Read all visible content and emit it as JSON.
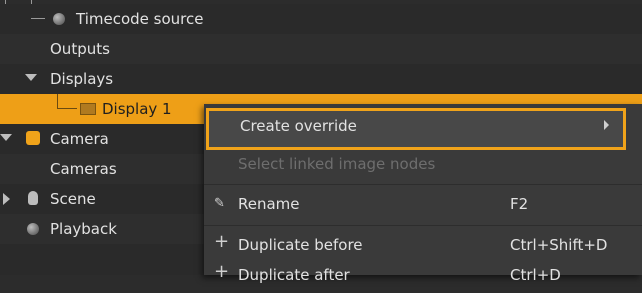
{
  "tree": {
    "items": [
      {
        "label": "Timecode source",
        "icon": "sphere-icon"
      },
      {
        "label": "Outputs"
      },
      {
        "label": "Displays",
        "icon": "expand-triangle-icon"
      },
      {
        "label": "Display 1",
        "icon": "display-icon",
        "selected": true
      },
      {
        "label": "Camera",
        "icon": "camera-node-icon"
      },
      {
        "label": "Cameras"
      },
      {
        "label": "Scene",
        "icon": "scene-icon"
      },
      {
        "label": "Playback",
        "icon": "sphere-icon"
      }
    ]
  },
  "context_menu": {
    "items": [
      {
        "label": "Create override",
        "has_submenu": true,
        "highlighted": true
      },
      {
        "label": "Select linked image nodes",
        "disabled": true
      },
      {
        "label": "Rename",
        "shortcut": "F2",
        "icon": "rename-icon"
      },
      {
        "label": "Duplicate before",
        "shortcut": "Ctrl+Shift+D",
        "icon": "plus-icon"
      },
      {
        "label": "Duplicate after",
        "shortcut": "Ctrl+D",
        "icon": "plus-icon"
      }
    ]
  },
  "colors": {
    "selection": "#ee9f17",
    "highlight_border": "#f0a31a",
    "background": "#2c2c2c",
    "menu": "#3a3a3a"
  }
}
